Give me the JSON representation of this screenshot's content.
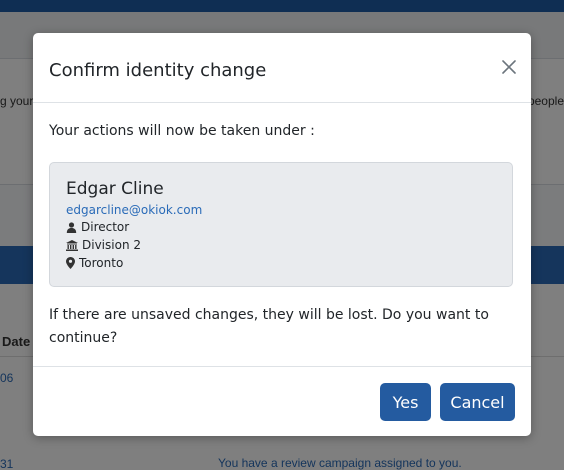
{
  "background": {
    "text_left": "g your",
    "text_right": "people",
    "date_header": "Date",
    "cell_1": "06",
    "cell_2": "31",
    "link": "You have a review campaign assigned to you."
  },
  "modal": {
    "title": "Confirm identity change",
    "intro": "Your actions will now be taken under :",
    "user": {
      "name": "Edgar Cline",
      "email": "edgarcline@okiok.com",
      "role": "Director",
      "division": "Division 2",
      "location": "Toronto"
    },
    "warning": "If there are unsaved changes, they will be lost. Do you want to continue?",
    "buttons": {
      "yes": "Yes",
      "cancel": "Cancel"
    }
  },
  "icons": [
    "close-icon",
    "user-icon",
    "institution-icon",
    "map-marker-icon"
  ],
  "colors": {
    "primary": "#245ba0",
    "link": "#2a6bb8",
    "card_bg": "#e9ebee",
    "topbar": "#1f5ca6"
  }
}
